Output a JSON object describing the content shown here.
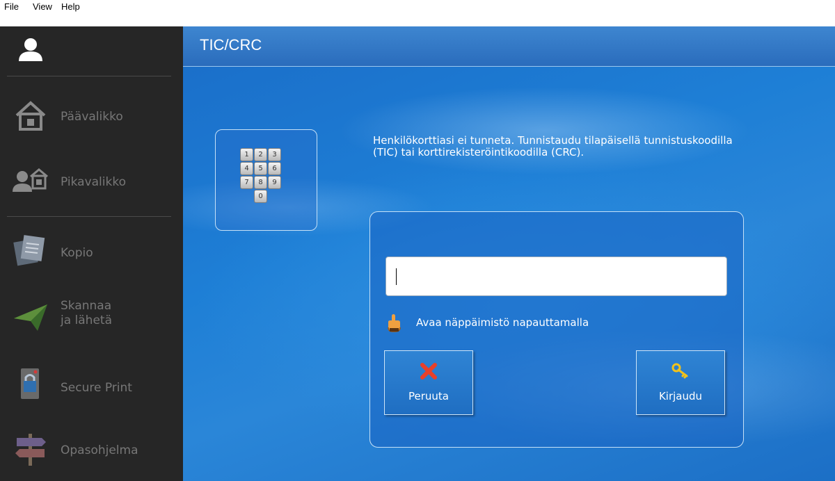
{
  "menu": {
    "file": "File",
    "view": "View",
    "help": "Help"
  },
  "sidebar": {
    "items": [
      {
        "label": "Päävalikko"
      },
      {
        "label": "Pikavalikko"
      },
      {
        "label": "Kopio"
      },
      {
        "label": "Skannaa\nja lähetä"
      },
      {
        "label": "Secure Print"
      },
      {
        "label": "Opasohjelma"
      }
    ]
  },
  "header": {
    "title": "TIC/CRC"
  },
  "keypad": {
    "keys": [
      "1",
      "2",
      "3",
      "4",
      "5",
      "6",
      "7",
      "8",
      "9",
      "0"
    ]
  },
  "message": "Henkilökorttiasi ei tunneta. Tunnistaudu tilapäisellä tunnistuskoodilla (TIC) tai korttirekisteröintikoodilla (CRC).",
  "form": {
    "code_value": "",
    "hint": "Avaa näppäimistö napauttamalla",
    "cancel_label": "Peruuta",
    "login_label": "Kirjaudu"
  },
  "colors": {
    "sidebar_bg": "#262626",
    "accent": "#1e7fd6",
    "cancel_icon": "#e8402a",
    "key_icon": "#f2c21a"
  }
}
